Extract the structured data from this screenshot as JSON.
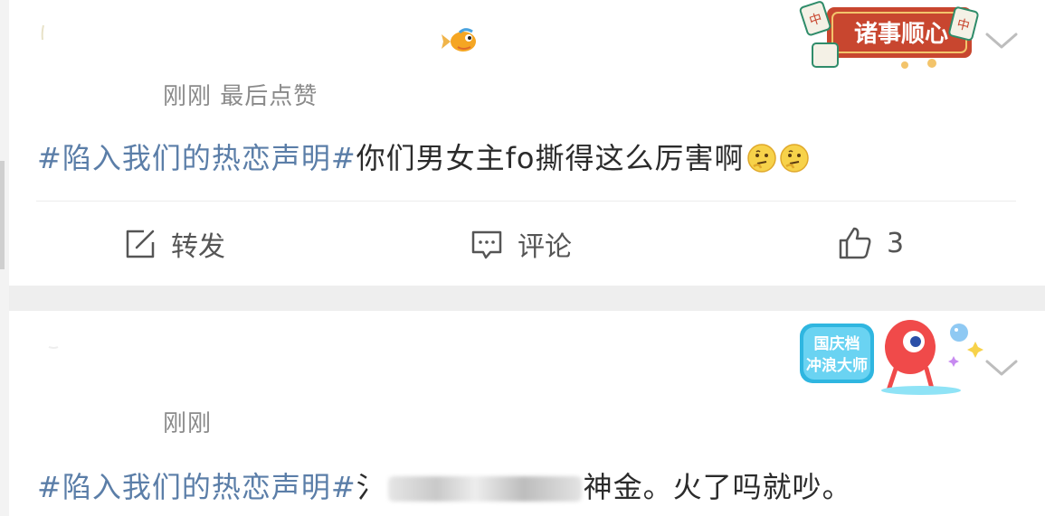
{
  "posts": [
    {
      "timeline": "刚刚 最后点赞",
      "topic": "#陷入我们的热恋声明#",
      "text": "你们男女主fo撕得这么厉害啊",
      "emoji": [
        "thinking-face",
        "thinking-face"
      ],
      "badge_text": "诸事顺心",
      "actions": {
        "repost": "转发",
        "comment": "评论",
        "like_count": "3"
      }
    },
    {
      "timeline": "刚刚",
      "topic": "#陷入我们的热恋声明#",
      "text_prefix": "氵",
      "text_suffix": "神金。火了吗就吵。",
      "badge_text_line1": "国庆档",
      "badge_text_line2": "冲浪大师"
    }
  ],
  "colors": {
    "topic": "#5b7ea8",
    "text": "#2b2b2b",
    "muted": "#8a8a8a",
    "separator": "#eeeeee"
  }
}
